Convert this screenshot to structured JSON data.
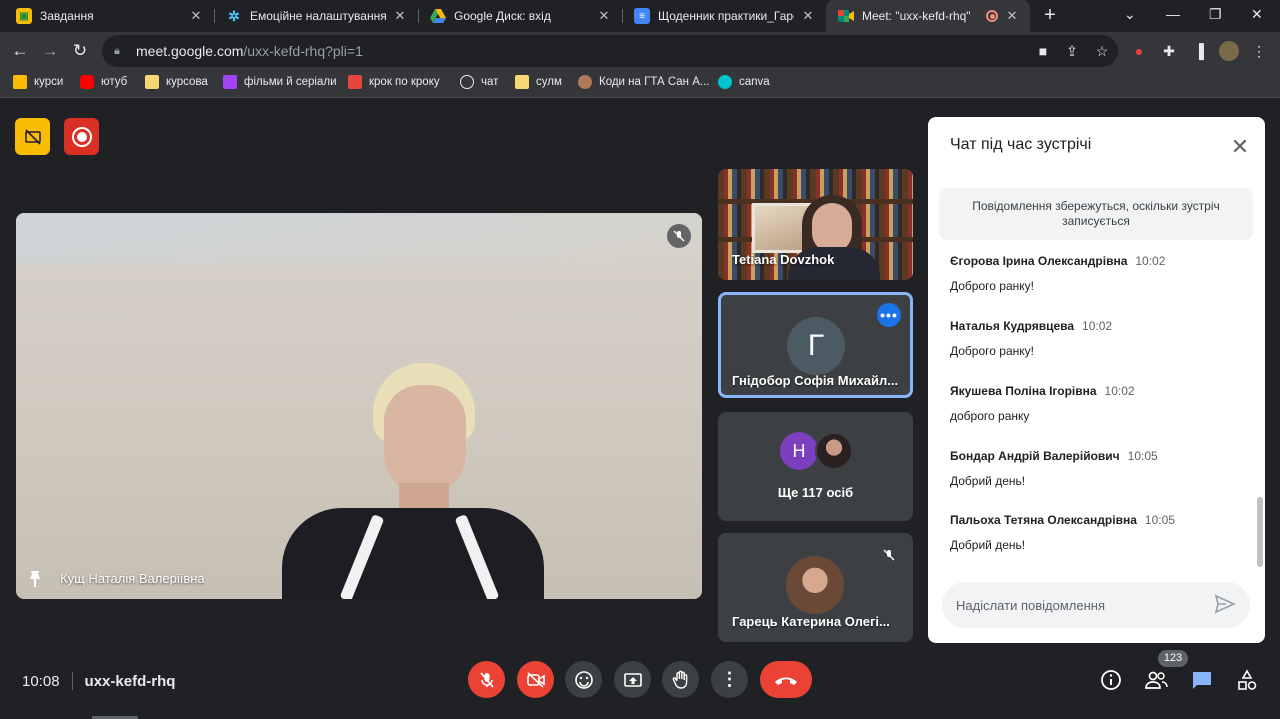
{
  "browser": {
    "tabs": [
      {
        "title": "Завдання",
        "icon": "classroom-icon",
        "color": "#fbbc04"
      },
      {
        "title": "Емоційне налаштування на",
        "icon": "snowflake-icon",
        "color": "#4fc3f7"
      },
      {
        "title": "Google Диск: вхід",
        "icon": "google-drive-icon",
        "color": "#34a853"
      },
      {
        "title": "Щоденник практики_Гарець",
        "icon": "google-docs-icon",
        "color": "#4285f4"
      },
      {
        "title": "Meet: \"uxx-kefd-rhq\"",
        "icon": "google-meet-icon",
        "color": "#00897b"
      }
    ],
    "url_host": "meet.google.com",
    "url_path": "/uxx-kefd-rhq?pli=1",
    "bookmarks": [
      {
        "label": "курси",
        "icon": "classroom-icon",
        "color": "#fbbc04"
      },
      {
        "label": "ютуб",
        "icon": "youtube-icon",
        "color": "#ff0000"
      },
      {
        "label": "курсова",
        "icon": "folder-icon",
        "color": "#f7d774"
      },
      {
        "label": "фільми й серіали",
        "icon": "video-icon",
        "color": "#a142f4"
      },
      {
        "label": "крок по кроку",
        "icon": "calendar-icon",
        "color": "#e8453c"
      },
      {
        "label": "чат",
        "icon": "openai-icon",
        "color": "#e8eaed"
      },
      {
        "label": "сулм",
        "icon": "folder-icon",
        "color": "#f7d774"
      },
      {
        "label": "Коди на ГТА Сан А...",
        "icon": "avatar-icon",
        "color": "#b07a5a"
      },
      {
        "label": "canva",
        "icon": "canva-icon",
        "color": "#00c4cc"
      }
    ]
  },
  "meet": {
    "main_participant": "Кущ Наталія Валеріївна",
    "tiles": [
      {
        "name": "Tetiana Dovzhok"
      },
      {
        "name": "Гнідобор Софія Михайл...",
        "initial": "Г"
      },
      {
        "name": "Ще 117 осіб",
        "initial": "Н"
      },
      {
        "name": "Гарець Катерина Олегі..."
      }
    ],
    "time": "10:08",
    "meeting_code": "uxx-kefd-rhq",
    "participants_count": "123"
  },
  "chat": {
    "title": "Чат під час зустрічі",
    "notice": "Повідомлення збережуться, оскільки зустріч записується",
    "messages": [
      {
        "sender": "Єгорова Ірина Олександрівна",
        "time": "10:02",
        "text": "Доброго ранку!"
      },
      {
        "sender": "Наталья Кудрявцева",
        "time": "10:02",
        "text": "Доброго ранку!"
      },
      {
        "sender": "Якушева Поліна Ігорівна",
        "time": "10:02",
        "text": "доброго ранку"
      },
      {
        "sender": "Бондар Андрій Валерійович",
        "time": "10:05",
        "text": "Добрий день!"
      },
      {
        "sender": "Пальоха Тетяна Олександрівна",
        "time": "10:05",
        "text": "Добрий день!"
      }
    ],
    "input_placeholder": "Надіслати повідомлення"
  },
  "colors": {
    "accent_blue": "#1a73e8",
    "danger_red": "#ea4335",
    "recording_yellow": "#fbbc04",
    "dark_bg": "#202124"
  }
}
